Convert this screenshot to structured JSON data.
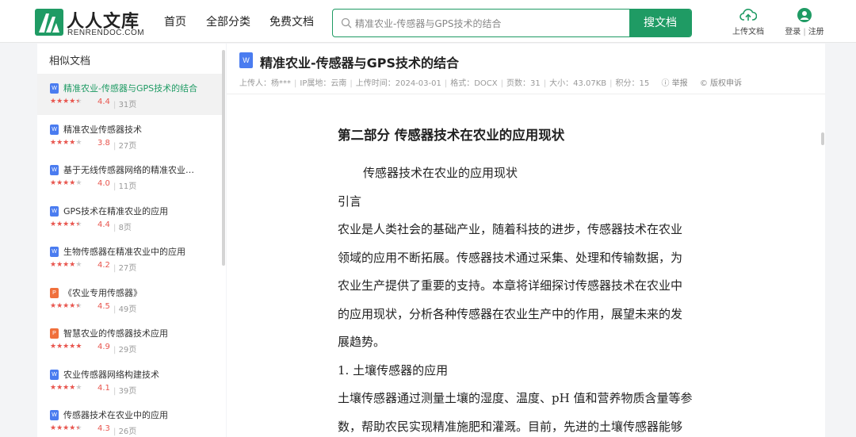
{
  "header": {
    "logo_cn": "人人文库",
    "logo_en": "RENRENDOC.COM",
    "nav": [
      "首页",
      "全部分类",
      "免费文档"
    ],
    "search_value": "精准农业-传感器与GPS技术的结合",
    "search_button": "搜文档",
    "upload_label": "上传文档",
    "login_label": "登录",
    "register_label": "注册",
    "accent_color": "#1f9b64"
  },
  "sidebar": {
    "title": "相似文档",
    "items": [
      {
        "title": "精准农业-传感器与GPS技术的结合",
        "badge": "W",
        "stars": 4.5,
        "score": "4.4",
        "pages": "31页",
        "active": true
      },
      {
        "title": "精准农业传感器技术",
        "badge": "W",
        "stars": 4,
        "score": "3.8",
        "pages": "27页"
      },
      {
        "title": "基于无线传感器网络的精准农业…",
        "badge": "W",
        "stars": 4,
        "score": "4.0",
        "pages": "11页"
      },
      {
        "title": "GPS技术在精准农业的应用",
        "badge": "W",
        "stars": 4.5,
        "score": "4.4",
        "pages": "8页"
      },
      {
        "title": "生物传感器在精准农业中的应用",
        "badge": "W",
        "stars": 4,
        "score": "4.2",
        "pages": "27页"
      },
      {
        "title": "《农业专用传感器》",
        "badge": "P",
        "stars": 4.5,
        "score": "4.5",
        "pages": "49页"
      },
      {
        "title": "智慧农业的传感器技术应用",
        "badge": "P",
        "stars": 5,
        "score": "4.9",
        "pages": "29页"
      },
      {
        "title": "农业传感器网络构建技术",
        "badge": "W",
        "stars": 4,
        "score": "4.1",
        "pages": "39页"
      },
      {
        "title": "传感器技术在农业中的应用",
        "badge": "W",
        "stars": 4.5,
        "score": "4.3",
        "pages": "26页"
      }
    ]
  },
  "document": {
    "badge": "W",
    "title": "精准农业-传感器与GPS技术的结合",
    "meta": [
      "上传人：杨***",
      "IP属地：云南",
      "上传时间：2024-03-01",
      "格式：DOCX",
      "页数：31",
      "大小：43.07KB",
      "积分：15"
    ],
    "report_label": "举报",
    "copyright_label": "版权申诉",
    "heading": "第二部分 传感器技术在农业的应用现状",
    "lines": [
      {
        "text": "传感器技术在农业的应用现状",
        "indent": true
      },
      {
        "text": "引言"
      },
      {
        "text": "农业是人类社会的基础产业，随着科技的进步，传感器技术在农业"
      },
      {
        "text": "领域的应用不断拓展。传感器技术通过采集、处理和传输数据，为"
      },
      {
        "text": "农业生产提供了重要的支持。本章将详细探讨传感器技术在农业中"
      },
      {
        "text": "的应用现状，分析各种传感器在农业生产中的作用，展望未来的发"
      },
      {
        "text": "展趋势。"
      },
      {
        "text": "1.  土壤传感器的应用"
      },
      {
        "text": "土壤传感器通过测量土壤的湿度、温度、pH 值和营养物质含量等参"
      },
      {
        "text": "数，帮助农民实现精准施肥和灌溉。目前，先进的土壤传感器能够"
      }
    ]
  }
}
